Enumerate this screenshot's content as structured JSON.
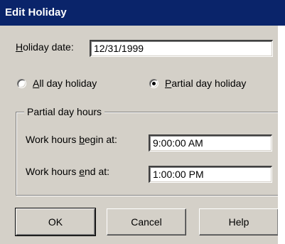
{
  "window": {
    "title": "Edit Holiday",
    "titlebar_color": "#0a246a",
    "face_color": "#d4d0c8"
  },
  "holiday_date": {
    "label_hotkey": "H",
    "label_rest": "oliday date:",
    "value": "12/31/1999"
  },
  "day_type": {
    "all_day": {
      "label_hotkey": "A",
      "label_rest": "ll day holiday",
      "selected": false
    },
    "partial_day": {
      "label_hotkey": "P",
      "label_rest": "artial day holiday",
      "selected": true
    }
  },
  "partial_hours": {
    "group_label": "Partial day hours",
    "begin": {
      "label_pre": "Work hours ",
      "label_hotkey": "b",
      "label_rest": "egin at:",
      "value": "9:00:00 AM"
    },
    "end": {
      "label_pre": "Work hours ",
      "label_hotkey": "e",
      "label_rest": "nd at:",
      "value": "1:00:00 PM"
    }
  },
  "buttons": {
    "ok": "OK",
    "cancel": "Cancel",
    "help": "Help"
  }
}
